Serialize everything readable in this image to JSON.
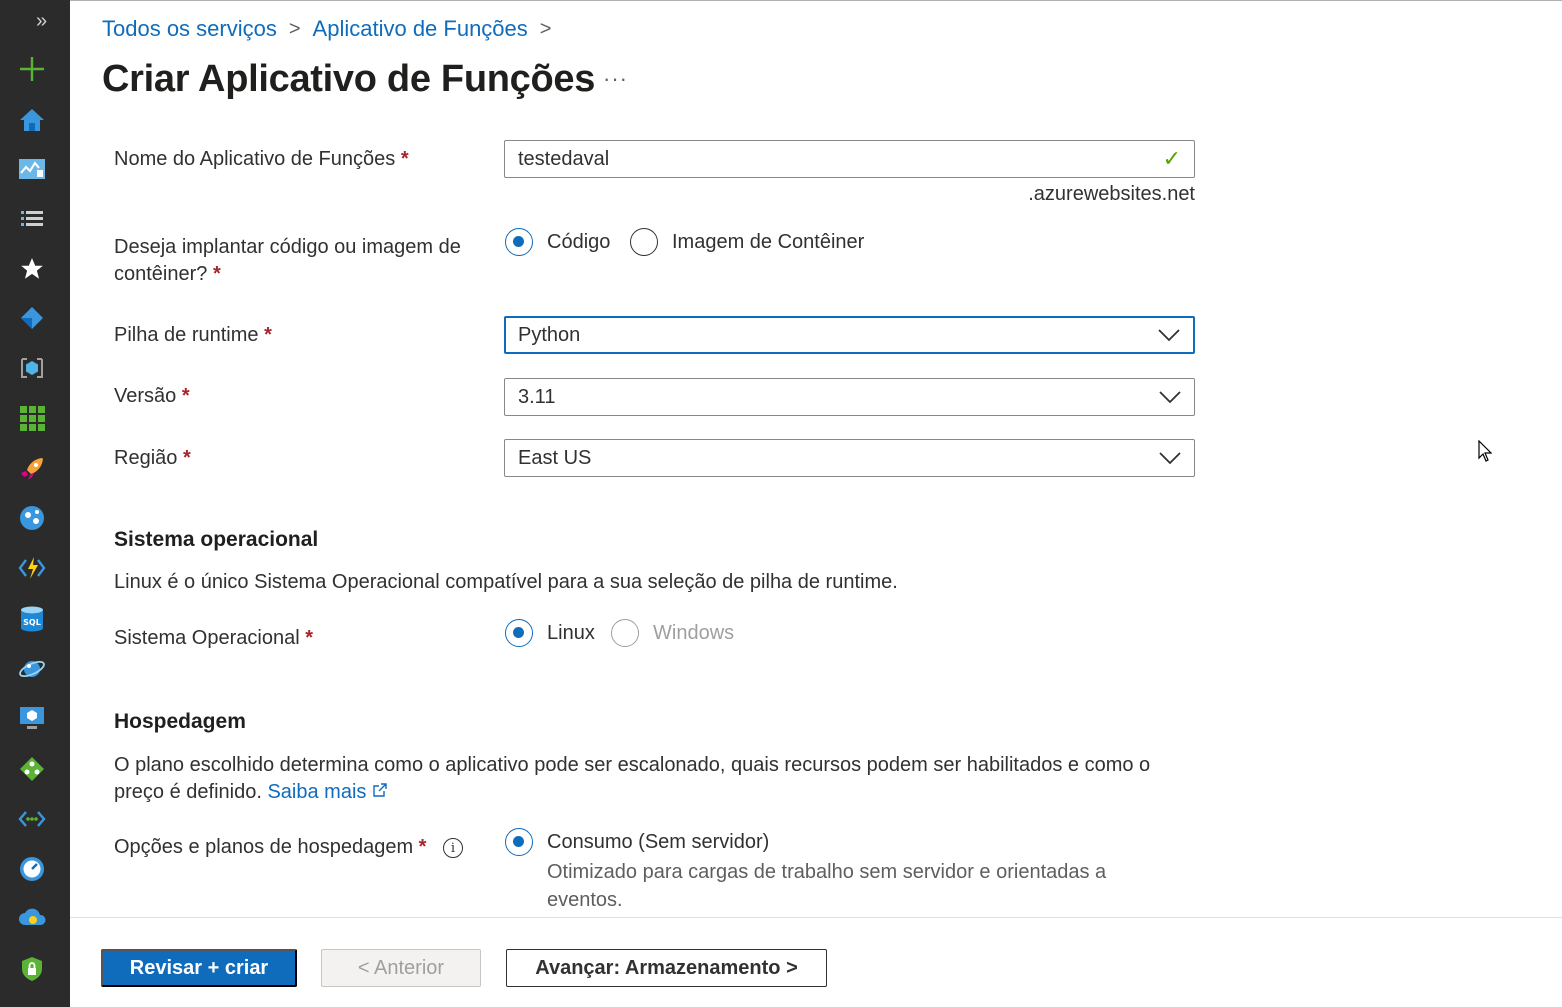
{
  "breadcrumb": {
    "items": [
      "Todos os serviços",
      "Aplicativo de Funções"
    ],
    "separator": ">"
  },
  "page": {
    "title": "Criar Aplicativo de Funções",
    "more_label": "···"
  },
  "form": {
    "required_marker": "*",
    "app_name": {
      "label": "Nome do Aplicativo de Funções",
      "value": "testedaval",
      "suffix": ".azurewebsites.net",
      "valid_mark": "✓"
    },
    "deploy": {
      "label": "Deseja implantar código ou imagem de contêiner?",
      "options": [
        "Código",
        "Imagem de Contêiner"
      ],
      "selected": "Código"
    },
    "runtime": {
      "label": "Pilha de runtime",
      "value": "Python"
    },
    "version": {
      "label": "Versão",
      "value": "3.11"
    },
    "region": {
      "label": "Região",
      "value": "East US"
    }
  },
  "os_section": {
    "heading": "Sistema operacional",
    "description": "Linux é o único Sistema Operacional compatível para a sua seleção de pilha de runtime.",
    "label": "Sistema Operacional",
    "options": [
      "Linux",
      "Windows"
    ],
    "selected": "Linux",
    "disabled": "Windows"
  },
  "hosting_section": {
    "heading": "Hospedagem",
    "description": "O plano escolhido determina como o aplicativo pode ser escalonado, quais recursos podem ser habilitados e como o preço é definido.",
    "learn_more": "Saiba mais",
    "label": "Opções e planos de hospedagem",
    "info_glyph": "i",
    "option": {
      "label": "Consumo (Sem servidor)",
      "description": "Otimizado para cargas de trabalho sem servidor e orientadas a eventos."
    }
  },
  "footer": {
    "review_create": "Revisar + criar",
    "previous": "< Anterior",
    "next": "Avançar: Armazenamento >"
  },
  "sidebar": {
    "expand_glyph": "»",
    "icons": [
      "create-resource-icon",
      "home-icon",
      "dashboard-icon",
      "all-services-icon",
      "favorites-icon",
      "azure-devops-icon",
      "container-icon",
      "all-resources-icon",
      "quickstart-icon",
      "app-services-icon",
      "function-app-icon",
      "sql-database-icon",
      "cosmos-db-icon",
      "virtual-machine-icon",
      "load-balancer-icon",
      "virtual-network-icon",
      "monitor-icon",
      "advisor-icon",
      "security-center-icon"
    ]
  },
  "colors": {
    "accent": "#0f6cbd",
    "required": "#a4262c",
    "valid": "#57a300",
    "rail": "#2b2b2b"
  }
}
